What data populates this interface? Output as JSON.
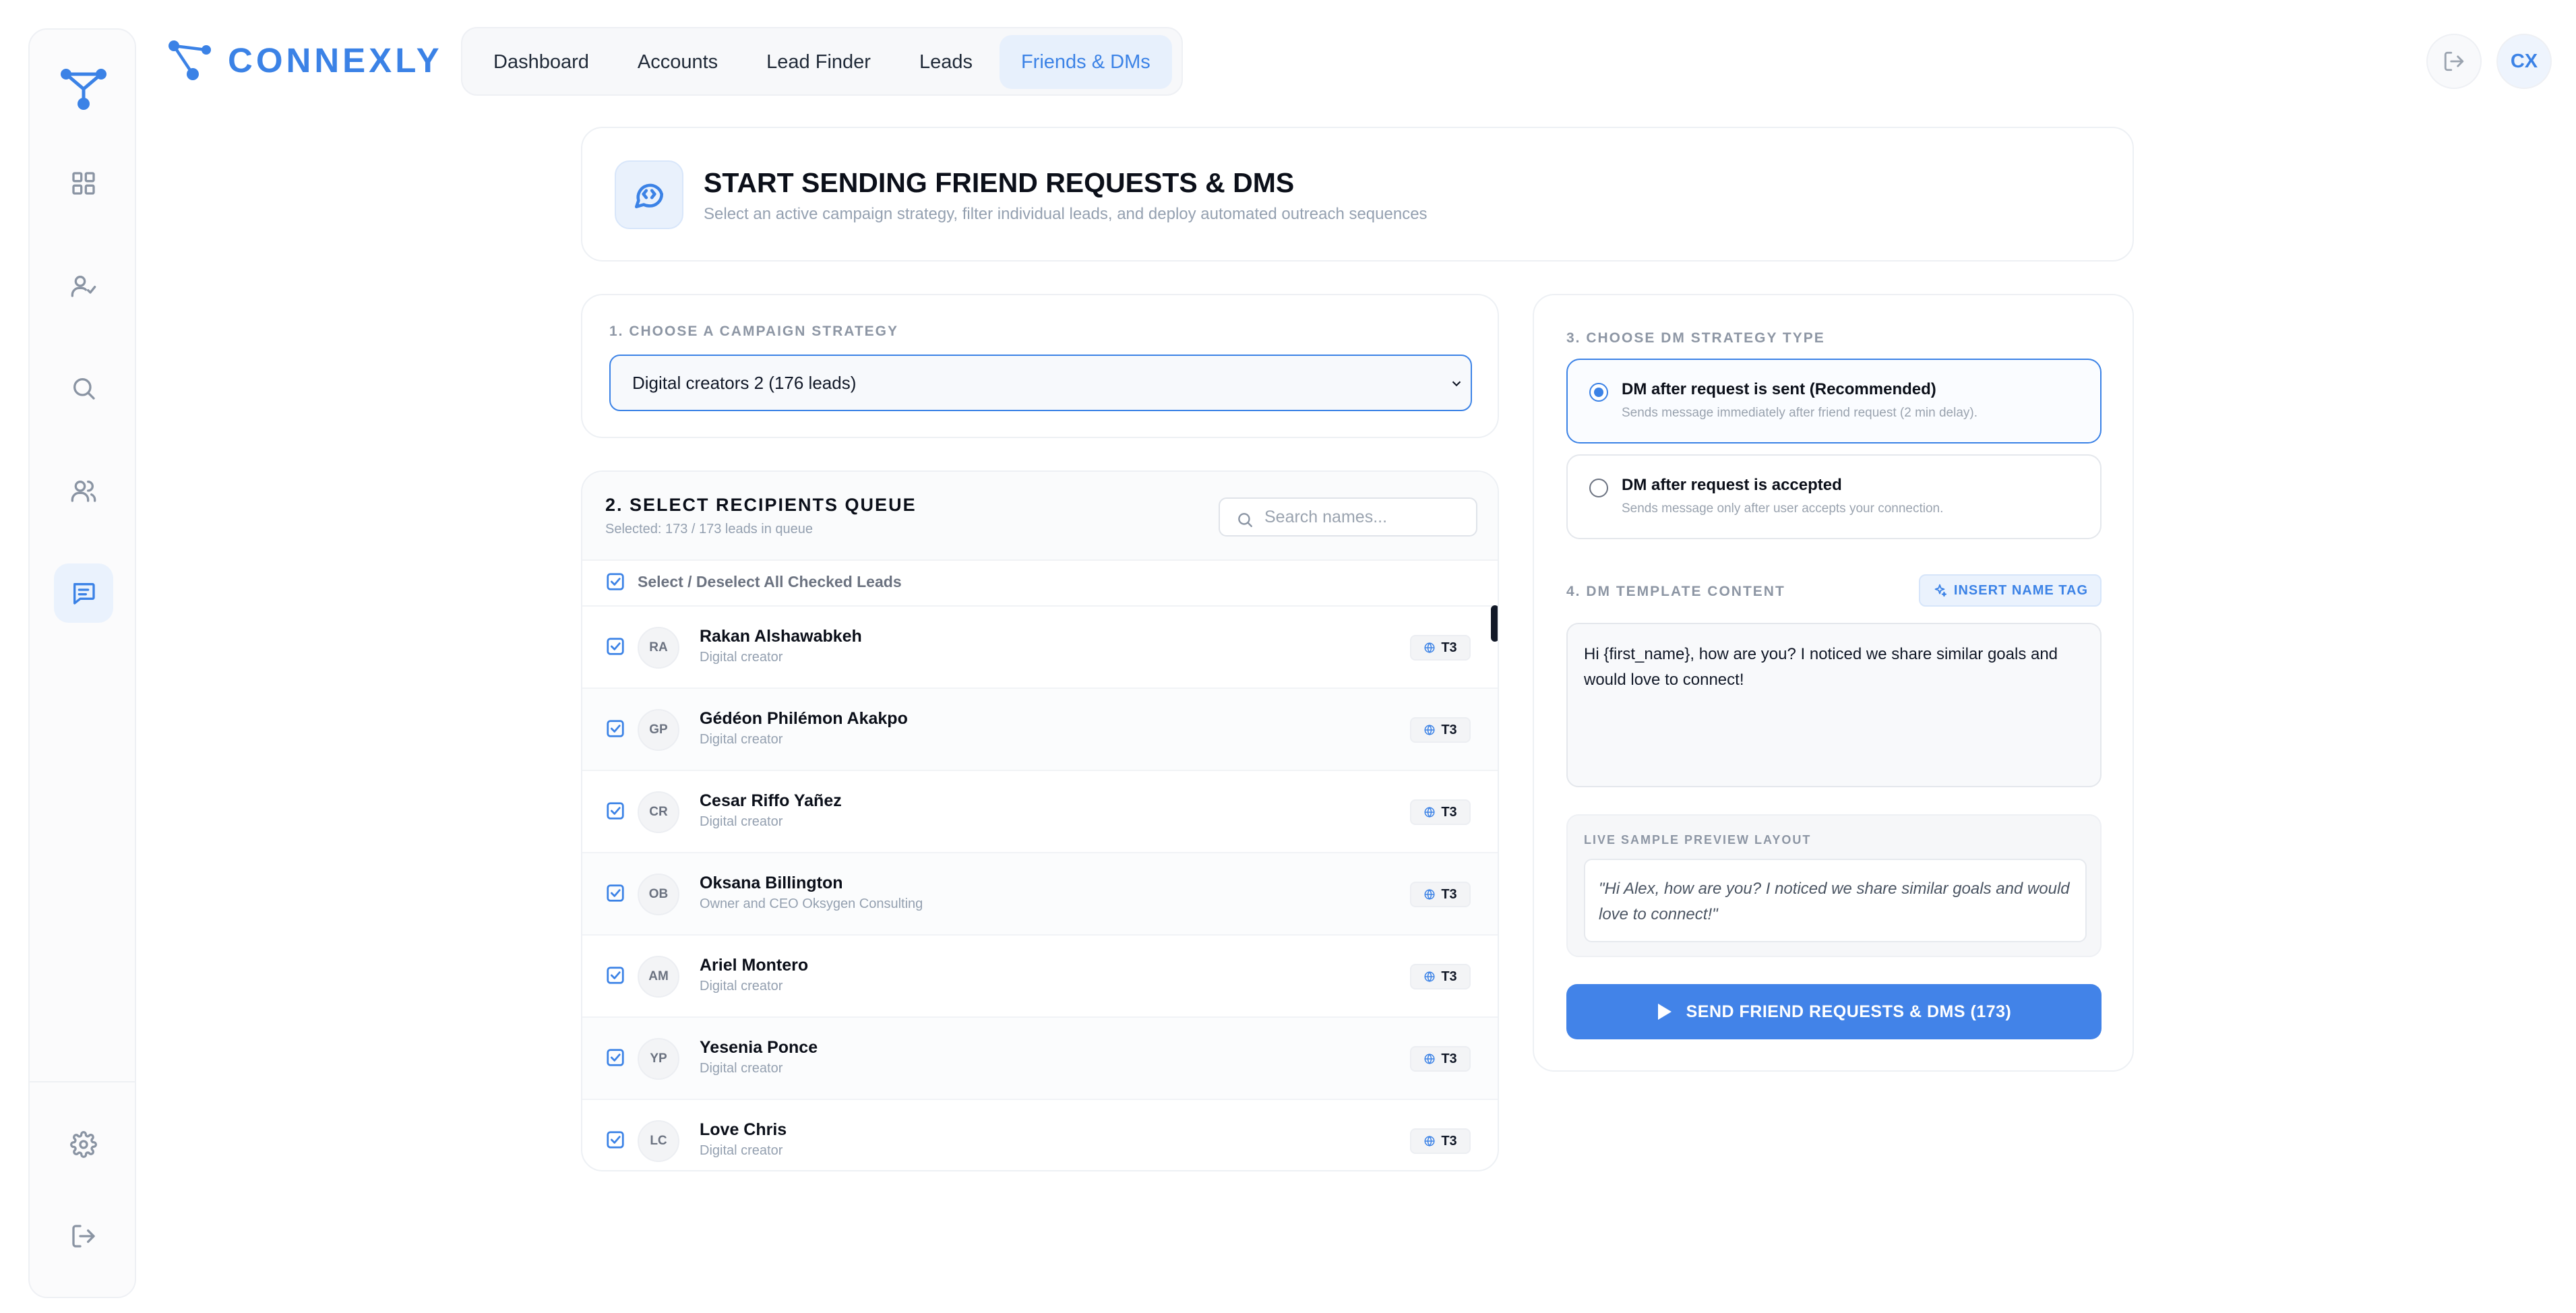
{
  "brand": {
    "name": "CONNEXLY"
  },
  "nav": {
    "tabs": [
      {
        "label": "Dashboard",
        "active": false
      },
      {
        "label": "Accounts",
        "active": false
      },
      {
        "label": "Lead Finder",
        "active": false
      },
      {
        "label": "Leads",
        "active": false
      },
      {
        "label": "Friends & DMs",
        "active": true
      }
    ]
  },
  "header": {
    "avatar_initials": "CX",
    "logout_icon": "logout-icon"
  },
  "sidebar": {
    "items": [
      {
        "icon": "grid-icon",
        "active": false
      },
      {
        "icon": "user-check-icon",
        "active": false
      },
      {
        "icon": "search-icon",
        "active": false
      },
      {
        "icon": "users-icon",
        "active": false
      },
      {
        "icon": "message-icon",
        "active": true
      },
      {
        "icon": "gear-icon",
        "active": false
      },
      {
        "icon": "logout-icon",
        "active": false
      }
    ]
  },
  "page": {
    "title": "START SENDING FRIEND REQUESTS & DMS",
    "subtitle": "Select an active campaign strategy, filter individual leads, and deploy automated outreach sequences"
  },
  "strategy": {
    "label": "1. CHOOSE A CAMPAIGN STRATEGY",
    "selected": "Digital creators 2 (176 leads)"
  },
  "queue": {
    "title": "2. SELECT RECIPIENTS QUEUE",
    "count_text": "Selected: 173 / 173 leads in queue",
    "search_placeholder": "Search names...",
    "select_all_label": "Select / Deselect All Checked Leads",
    "rows": [
      {
        "initials": "RA",
        "name": "Rakan Alshawabkeh",
        "role": "Digital creator",
        "tier": "T3",
        "checked": true
      },
      {
        "initials": "GP",
        "name": "Gédéon Philémon Akakpo",
        "role": "Digital creator",
        "tier": "T3",
        "checked": true
      },
      {
        "initials": "CR",
        "name": "Cesar Riffo Yañez",
        "role": "Digital creator",
        "tier": "T3",
        "checked": true
      },
      {
        "initials": "OB",
        "name": "Oksana Billington",
        "role": "Owner and CEO Oksygen Consulting",
        "tier": "T3",
        "checked": true
      },
      {
        "initials": "AM",
        "name": "Ariel Montero",
        "role": "Digital creator",
        "tier": "T3",
        "checked": true
      },
      {
        "initials": "YP",
        "name": "Yesenia Ponce",
        "role": "Digital creator",
        "tier": "T3",
        "checked": true
      },
      {
        "initials": "LC",
        "name": "Love Chris",
        "role": "Digital creator",
        "tier": "T3",
        "checked": true
      }
    ]
  },
  "dm": {
    "strategy_label": "3. CHOOSE DM STRATEGY TYPE",
    "options": [
      {
        "title": "DM after request is sent (Recommended)",
        "desc": "Sends message immediately after friend request (2 min delay).",
        "selected": true
      },
      {
        "title": "DM after request is accepted",
        "desc": "Sends message only after user accepts your connection.",
        "selected": false
      }
    ],
    "template_label": "4. DM TEMPLATE CONTENT",
    "insert_tag_label": "INSERT NAME TAG",
    "template": "Hi {first_name}, how are you? I noticed we share similar goals and would love to connect!",
    "preview_label": "LIVE SAMPLE PREVIEW LAYOUT",
    "preview": "\"Hi Alex, how are you? I noticed we share similar goals and would love to connect!\"",
    "send_label": "SEND FRIEND REQUESTS & DMS (173)"
  },
  "colors": {
    "accent": "#3b82e6",
    "button": "#4283e8",
    "muted": "#94a0b0"
  }
}
